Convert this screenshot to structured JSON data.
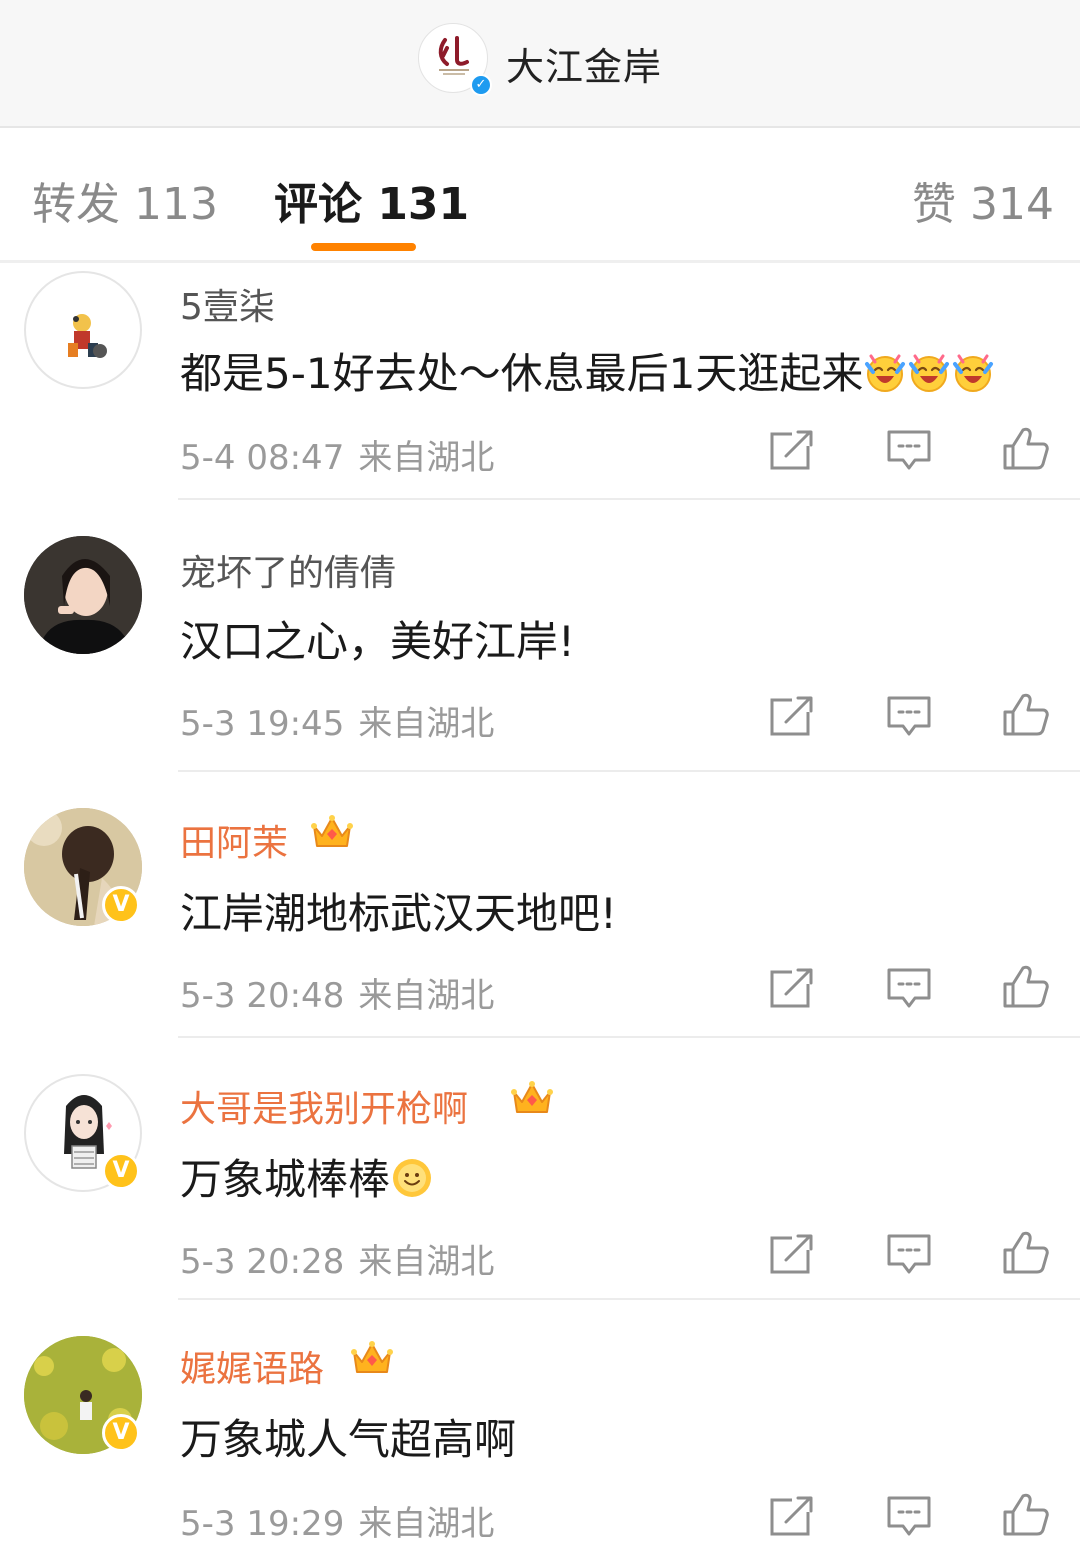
{
  "header": {
    "account_name": "大江金岸"
  },
  "tabs": {
    "repost": "转发 113",
    "comment": "评论 131",
    "like": "赞 314"
  },
  "comments": [
    {
      "user": "5壹柒",
      "text": "都是5-1好去处～休息最后1天逛起来",
      "date": "5-4 08:47",
      "source": "来自湖北"
    },
    {
      "user": "宠坏了的倩倩",
      "text": "汉口之心，美好江岸!",
      "date": "5-3 19:45",
      "source": "来自湖北"
    },
    {
      "user": "田阿茉",
      "text": "江岸潮地标武汉天地吧!",
      "date": "5-3 20:48",
      "source": "来自湖北"
    },
    {
      "user": "大哥是我别开枪啊",
      "text": "万象城棒棒",
      "date": "5-3 20:28",
      "source": "来自湖北"
    },
    {
      "user": "娓娓语路",
      "text": "万象城人气超高啊",
      "date": "5-3 19:29",
      "source": "来自湖北"
    }
  ],
  "colors": {
    "accent": "#ff8200",
    "vip_name": "#eb7340",
    "verified_blue": "#1e9bf0",
    "verified_yellow": "#ffc21a"
  },
  "icons": [
    "share-icon",
    "comment-icon",
    "thumbs-up-icon",
    "crown-icon",
    "laughing-emoji-icon",
    "smile-emoji-icon",
    "verified-badge-icon"
  ]
}
